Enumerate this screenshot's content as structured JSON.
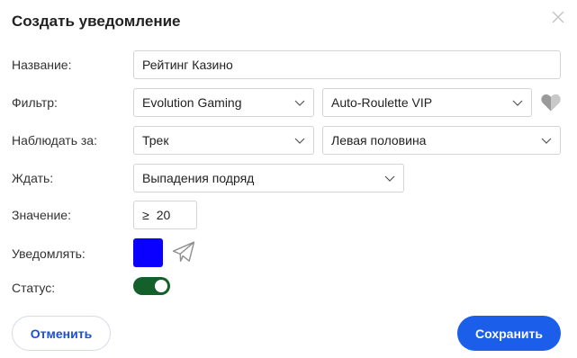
{
  "dialog": {
    "title": "Создать уведомление"
  },
  "form": {
    "name": {
      "label": "Название:",
      "value": "Рейтинг Казино"
    },
    "filter": {
      "label": "Фильтр:",
      "provider": "Evolution Gaming",
      "table": "Auto-Roulette VIP"
    },
    "watch": {
      "label": "Наблюдать за:",
      "target": "Трек",
      "area": "Левая половина"
    },
    "wait": {
      "label": "Ждать:",
      "condition": "Выпадения подряд"
    },
    "value": {
      "label": "Значение:",
      "operator": "≥",
      "number": "20"
    },
    "notify": {
      "label": "Уведомлять:",
      "color": "#0a00ff",
      "channel_icon": "telegram-icon"
    },
    "status": {
      "label": "Статус:",
      "enabled": true,
      "on_color": "#14602a"
    }
  },
  "buttons": {
    "cancel": "Отменить",
    "save": "Сохранить"
  },
  "colors": {
    "accent": "#1a5eea",
    "cancel_text": "#1d4ed8"
  }
}
